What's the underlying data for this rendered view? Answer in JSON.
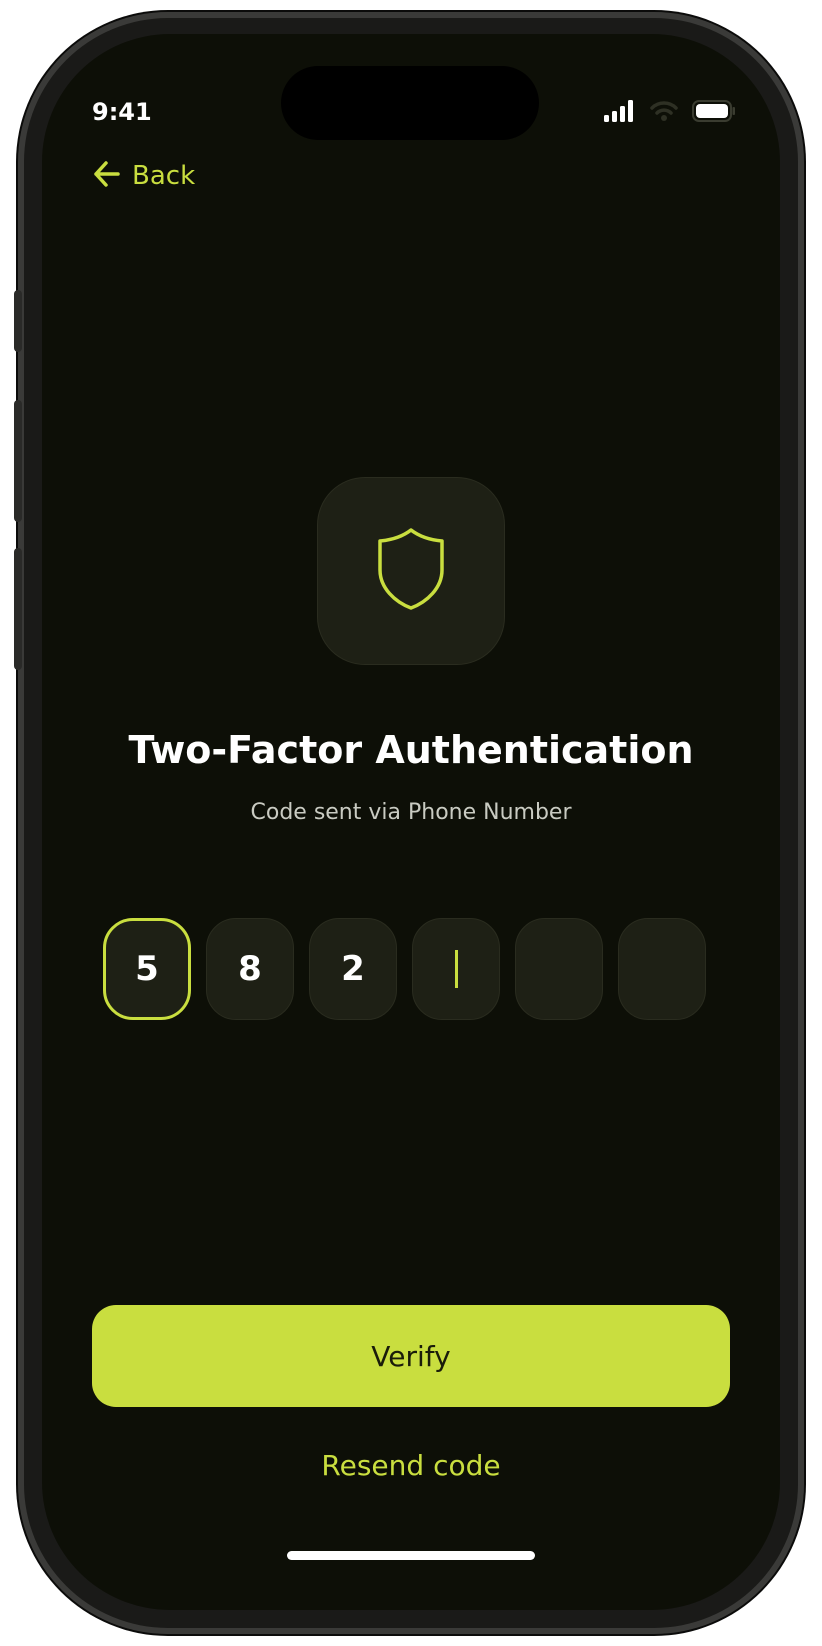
{
  "status_bar": {
    "time": "9:41",
    "icons": [
      "signal-icon",
      "wifi-icon",
      "battery-icon"
    ]
  },
  "nav": {
    "back_label": "Back",
    "back_icon": "arrow-left-icon"
  },
  "header": {
    "icon": "shield-icon",
    "title": "Two-Factor Authentication",
    "subtitle": "Code sent via Phone Number"
  },
  "otp": {
    "digits": [
      "5",
      "8",
      "2",
      "",
      "",
      ""
    ],
    "active_index": 0,
    "cursor_index": 3
  },
  "actions": {
    "verify_label": "Verify",
    "resend_label": "Resend code"
  },
  "colors": {
    "accent": "#c9de3f",
    "background": "#0d0f07",
    "tile": "#1e2015",
    "text": "#ffffff"
  }
}
